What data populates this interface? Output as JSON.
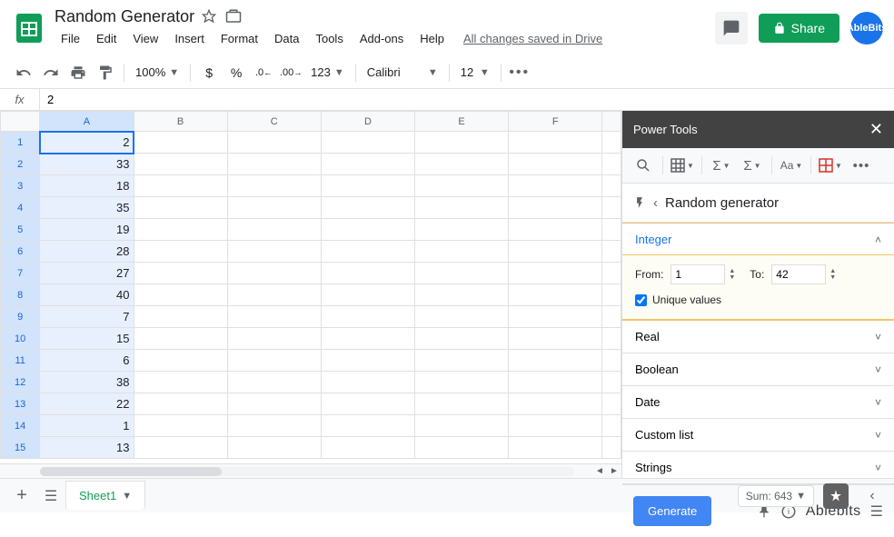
{
  "doc_title": "Random Generator",
  "menus": [
    "File",
    "Edit",
    "View",
    "Insert",
    "Format",
    "Data",
    "Tools",
    "Add-ons",
    "Help"
  ],
  "save_status": "All changes saved in Drive",
  "share_label": "Share",
  "avatar_label": "AbleBits",
  "toolbar": {
    "zoom": "100%",
    "currency": "$",
    "percent": "%",
    "dec_dec": ".0",
    "inc_dec": ".00",
    "more_formats": "123",
    "font": "Calibri",
    "font_size": "12"
  },
  "formula_bar": {
    "label": "fx",
    "value": "2"
  },
  "columns": [
    "A",
    "B",
    "C",
    "D",
    "E",
    "F"
  ],
  "rows": [
    {
      "n": 1,
      "a": "2"
    },
    {
      "n": 2,
      "a": "33"
    },
    {
      "n": 3,
      "a": "18"
    },
    {
      "n": 4,
      "a": "35"
    },
    {
      "n": 5,
      "a": "19"
    },
    {
      "n": 6,
      "a": "28"
    },
    {
      "n": 7,
      "a": "27"
    },
    {
      "n": 8,
      "a": "40"
    },
    {
      "n": 9,
      "a": "7"
    },
    {
      "n": 10,
      "a": "15"
    },
    {
      "n": 11,
      "a": "6"
    },
    {
      "n": 12,
      "a": "38"
    },
    {
      "n": 13,
      "a": "22"
    },
    {
      "n": 14,
      "a": "1"
    },
    {
      "n": 15,
      "a": "13"
    }
  ],
  "panel": {
    "title": "Power Tools",
    "breadcrumb": "Random generator",
    "sections": {
      "integer": {
        "label": "Integer",
        "from_label": "From:",
        "from_value": "1",
        "to_label": "To:",
        "to_value": "42",
        "unique_label": "Unique values",
        "unique_checked": true
      },
      "real": "Real",
      "boolean": "Boolean",
      "date": "Date",
      "custom": "Custom list",
      "strings": "Strings"
    },
    "generate_label": "Generate",
    "brand": "Ablebits"
  },
  "bottom": {
    "sheet_name": "Sheet1",
    "sum_label": "Sum: 643"
  }
}
